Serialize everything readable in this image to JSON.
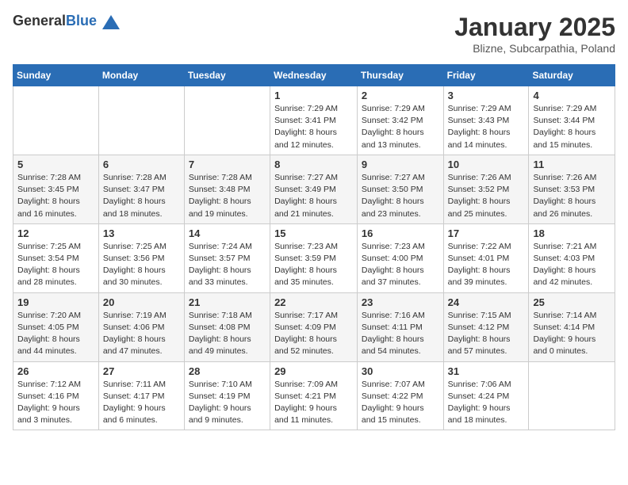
{
  "header": {
    "logo_general": "General",
    "logo_blue": "Blue",
    "title": "January 2025",
    "location": "Blizne, Subcarpathia, Poland"
  },
  "days_of_week": [
    "Sunday",
    "Monday",
    "Tuesday",
    "Wednesday",
    "Thursday",
    "Friday",
    "Saturday"
  ],
  "weeks": [
    [
      {
        "day": "",
        "info": ""
      },
      {
        "day": "",
        "info": ""
      },
      {
        "day": "",
        "info": ""
      },
      {
        "day": "1",
        "info": "Sunrise: 7:29 AM\nSunset: 3:41 PM\nDaylight: 8 hours\nand 12 minutes."
      },
      {
        "day": "2",
        "info": "Sunrise: 7:29 AM\nSunset: 3:42 PM\nDaylight: 8 hours\nand 13 minutes."
      },
      {
        "day": "3",
        "info": "Sunrise: 7:29 AM\nSunset: 3:43 PM\nDaylight: 8 hours\nand 14 minutes."
      },
      {
        "day": "4",
        "info": "Sunrise: 7:29 AM\nSunset: 3:44 PM\nDaylight: 8 hours\nand 15 minutes."
      }
    ],
    [
      {
        "day": "5",
        "info": "Sunrise: 7:28 AM\nSunset: 3:45 PM\nDaylight: 8 hours\nand 16 minutes."
      },
      {
        "day": "6",
        "info": "Sunrise: 7:28 AM\nSunset: 3:47 PM\nDaylight: 8 hours\nand 18 minutes."
      },
      {
        "day": "7",
        "info": "Sunrise: 7:28 AM\nSunset: 3:48 PM\nDaylight: 8 hours\nand 19 minutes."
      },
      {
        "day": "8",
        "info": "Sunrise: 7:27 AM\nSunset: 3:49 PM\nDaylight: 8 hours\nand 21 minutes."
      },
      {
        "day": "9",
        "info": "Sunrise: 7:27 AM\nSunset: 3:50 PM\nDaylight: 8 hours\nand 23 minutes."
      },
      {
        "day": "10",
        "info": "Sunrise: 7:26 AM\nSunset: 3:52 PM\nDaylight: 8 hours\nand 25 minutes."
      },
      {
        "day": "11",
        "info": "Sunrise: 7:26 AM\nSunset: 3:53 PM\nDaylight: 8 hours\nand 26 minutes."
      }
    ],
    [
      {
        "day": "12",
        "info": "Sunrise: 7:25 AM\nSunset: 3:54 PM\nDaylight: 8 hours\nand 28 minutes."
      },
      {
        "day": "13",
        "info": "Sunrise: 7:25 AM\nSunset: 3:56 PM\nDaylight: 8 hours\nand 30 minutes."
      },
      {
        "day": "14",
        "info": "Sunrise: 7:24 AM\nSunset: 3:57 PM\nDaylight: 8 hours\nand 33 minutes."
      },
      {
        "day": "15",
        "info": "Sunrise: 7:23 AM\nSunset: 3:59 PM\nDaylight: 8 hours\nand 35 minutes."
      },
      {
        "day": "16",
        "info": "Sunrise: 7:23 AM\nSunset: 4:00 PM\nDaylight: 8 hours\nand 37 minutes."
      },
      {
        "day": "17",
        "info": "Sunrise: 7:22 AM\nSunset: 4:01 PM\nDaylight: 8 hours\nand 39 minutes."
      },
      {
        "day": "18",
        "info": "Sunrise: 7:21 AM\nSunset: 4:03 PM\nDaylight: 8 hours\nand 42 minutes."
      }
    ],
    [
      {
        "day": "19",
        "info": "Sunrise: 7:20 AM\nSunset: 4:05 PM\nDaylight: 8 hours\nand 44 minutes."
      },
      {
        "day": "20",
        "info": "Sunrise: 7:19 AM\nSunset: 4:06 PM\nDaylight: 8 hours\nand 47 minutes."
      },
      {
        "day": "21",
        "info": "Sunrise: 7:18 AM\nSunset: 4:08 PM\nDaylight: 8 hours\nand 49 minutes."
      },
      {
        "day": "22",
        "info": "Sunrise: 7:17 AM\nSunset: 4:09 PM\nDaylight: 8 hours\nand 52 minutes."
      },
      {
        "day": "23",
        "info": "Sunrise: 7:16 AM\nSunset: 4:11 PM\nDaylight: 8 hours\nand 54 minutes."
      },
      {
        "day": "24",
        "info": "Sunrise: 7:15 AM\nSunset: 4:12 PM\nDaylight: 8 hours\nand 57 minutes."
      },
      {
        "day": "25",
        "info": "Sunrise: 7:14 AM\nSunset: 4:14 PM\nDaylight: 9 hours\nand 0 minutes."
      }
    ],
    [
      {
        "day": "26",
        "info": "Sunrise: 7:12 AM\nSunset: 4:16 PM\nDaylight: 9 hours\nand 3 minutes."
      },
      {
        "day": "27",
        "info": "Sunrise: 7:11 AM\nSunset: 4:17 PM\nDaylight: 9 hours\nand 6 minutes."
      },
      {
        "day": "28",
        "info": "Sunrise: 7:10 AM\nSunset: 4:19 PM\nDaylight: 9 hours\nand 9 minutes."
      },
      {
        "day": "29",
        "info": "Sunrise: 7:09 AM\nSunset: 4:21 PM\nDaylight: 9 hours\nand 11 minutes."
      },
      {
        "day": "30",
        "info": "Sunrise: 7:07 AM\nSunset: 4:22 PM\nDaylight: 9 hours\nand 15 minutes."
      },
      {
        "day": "31",
        "info": "Sunrise: 7:06 AM\nSunset: 4:24 PM\nDaylight: 9 hours\nand 18 minutes."
      },
      {
        "day": "",
        "info": ""
      }
    ]
  ]
}
